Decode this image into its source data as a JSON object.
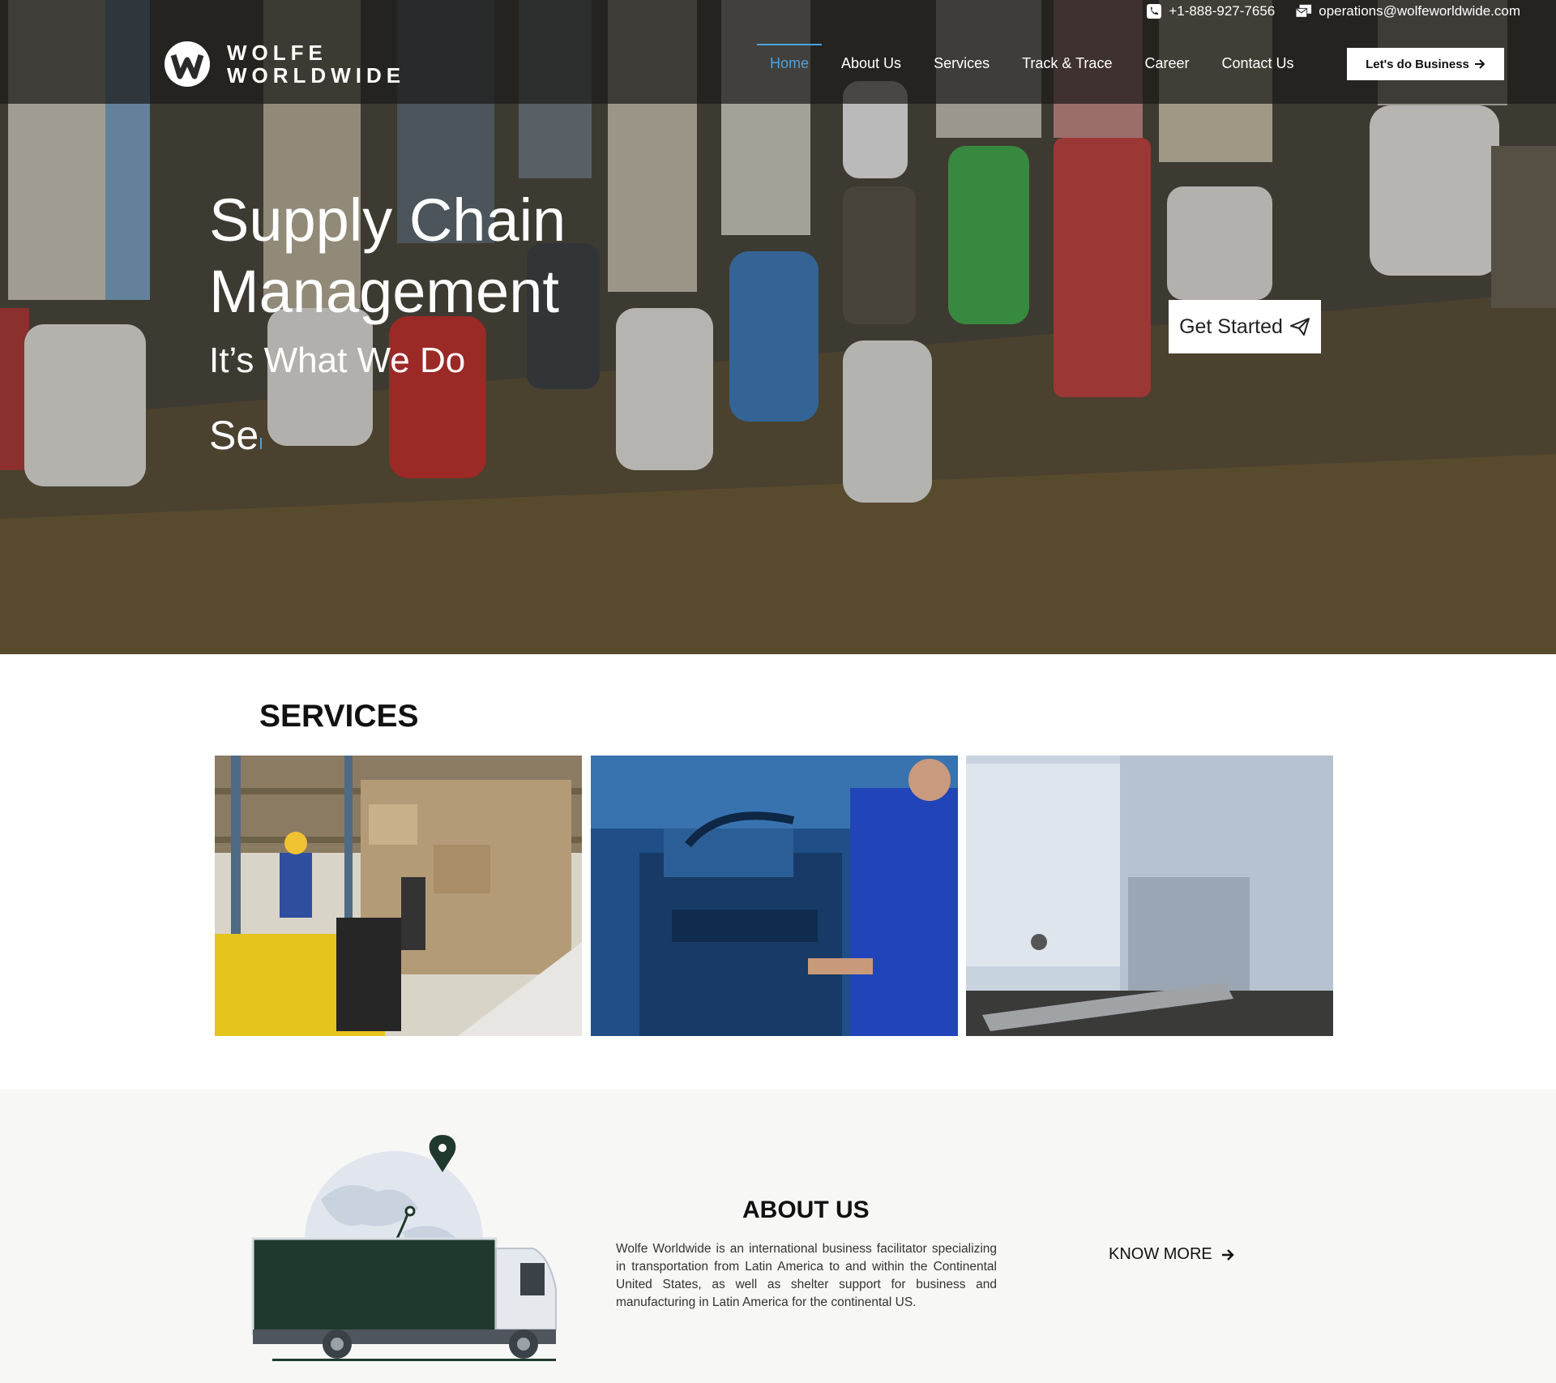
{
  "header": {
    "phone": "+1-888-927-7656",
    "email": "operations@wolfeworldwide.com",
    "logo_line1": "WOLFE",
    "logo_line2": "WORLDWIDE",
    "nav": [
      {
        "label": "Home",
        "active": true
      },
      {
        "label": "About Us",
        "active": false
      },
      {
        "label": "Services",
        "active": false
      },
      {
        "label": "Track & Trace",
        "active": false
      },
      {
        "label": "Career",
        "active": false
      },
      {
        "label": "Contact Us",
        "active": false
      }
    ],
    "cta_label": "Let's do Business",
    "accent_color": "#4aa3df"
  },
  "hero": {
    "title": "Supply Chain Management",
    "subtitle": "It’s What We Do",
    "typing_text": "Se",
    "button_label": "Get Started"
  },
  "services": {
    "title": "SERVICES",
    "cards": [
      {
        "image": "warehouse-forklift"
      },
      {
        "image": "manufacturing-machine"
      },
      {
        "image": "cargo-trailers"
      }
    ]
  },
  "about": {
    "title": "ABOUT US",
    "text": "Wolfe Worldwide is an international business facilitator specializing in transportation from Latin America to and within the Continental United States, as well as shelter support for business and manufacturing in Latin America for the continental US.",
    "link_label": "KNOW MORE",
    "truck_color": "#1f3a2c"
  }
}
